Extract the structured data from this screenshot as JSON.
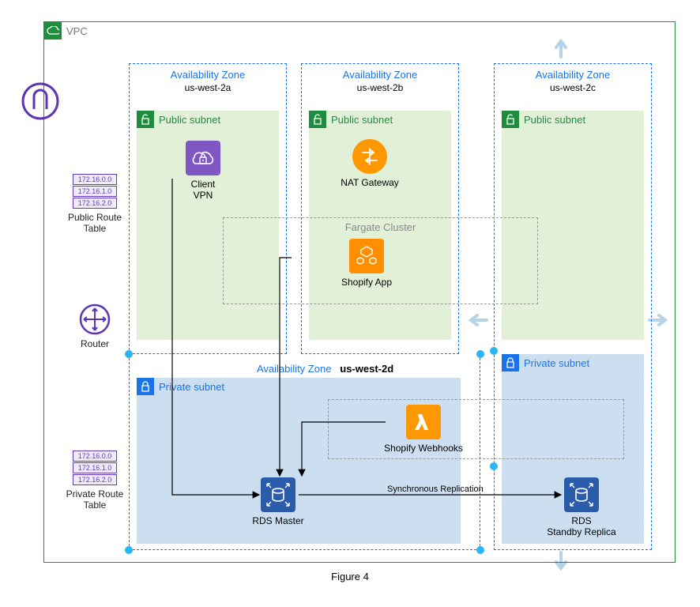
{
  "vpc": {
    "label": "VPC"
  },
  "caption": "Figure 4",
  "az": [
    {
      "title": "Availability Zone",
      "id": "us-west-2a"
    },
    {
      "title": "Availability Zone",
      "id": "us-west-2b"
    },
    {
      "title": "Availability Zone",
      "id": "us-west-2c"
    },
    {
      "title": "Availability Zone",
      "id": "us-west-2d"
    }
  ],
  "subnet": {
    "public_label": "Public subnet",
    "private_label": "Private subnet"
  },
  "services": {
    "client_vpn": "Client\nVPN",
    "nat": "NAT Gateway",
    "fargate_title": "Fargate Cluster",
    "shopify_app": "Shopify App",
    "shopify_webhooks": "Shopify Webhooks",
    "rds_master": "RDS Master",
    "rds_standby": "RDS\nStandby Replica",
    "sync_repl": "Synchronous Replication"
  },
  "left": {
    "public_rt": "Public Route Table",
    "private_rt": "Private Route Table",
    "router": "Router",
    "cidrs": [
      "172.16.0.0",
      "172.16.1.0",
      "172.16.2.0"
    ]
  },
  "colors": {
    "vpn": "#7e57c2",
    "nat": "#ff9800",
    "ecs": "#ff8f00",
    "lambda": "#ff9800",
    "rds": "#2a5caa"
  }
}
